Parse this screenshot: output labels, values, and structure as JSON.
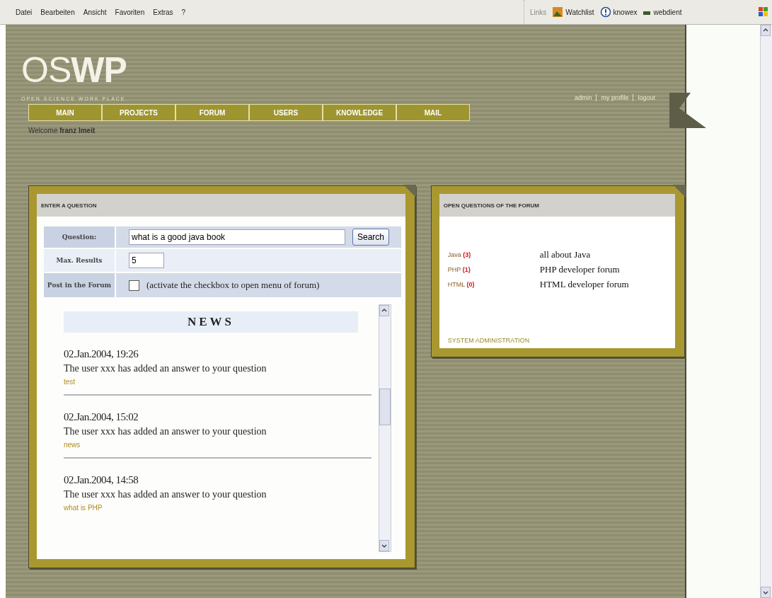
{
  "menu_bar": {
    "items": [
      "Datei",
      "Bearbeiten",
      "Ansicht",
      "Favoriten",
      "Extras",
      "?"
    ],
    "links_label": "Links",
    "links": [
      {
        "label": "Watchlist",
        "kind": "image"
      },
      {
        "label": "knowex",
        "kind": "help"
      },
      {
        "label": "webdient",
        "kind": "device"
      }
    ]
  },
  "header": {
    "logo_light": "OS",
    "logo_bold": "WP",
    "tagline": "OPEN SCIENCE WORK PLACE",
    "user_links": [
      "admin",
      "my profile",
      "logout"
    ]
  },
  "nav": [
    "MAIN",
    "PROJECTS",
    "FORUM",
    "USERS",
    "KNOWLEDGE",
    "MAIL"
  ],
  "welcome": "Welcome **franz lmeit**",
  "question_card": {
    "title": "ENTER A QUESTION",
    "question_label": "Question:",
    "question_value": "what is a good java book",
    "search_button": "Search",
    "max_label": "Max. Results",
    "max_value": "5",
    "post_label": "Post in the Forum",
    "post_checked": false,
    "post_hint": "(activate the checkbox to open menu of forum)",
    "news_title": "NEWS",
    "news": [
      {
        "date": "02.Jan.2004, 19:26",
        "text": "The user xxx has added an answer to your question",
        "link": "test"
      },
      {
        "date": "02.Jan.2004, 15:02",
        "text": "The user xxx has added an answer to your question",
        "link": "news"
      },
      {
        "date": "02.Jan.2004, 14:58",
        "text": "The user xxx has added an answer to your question",
        "link": "what is PHP"
      }
    ]
  },
  "forum_card": {
    "title": "OPEN QUESTIONS OF THE FORUM",
    "forums": [
      {
        "name": "Java",
        "count": "(3)",
        "description": "all about Java"
      },
      {
        "name": "PHP",
        "count": "(1)",
        "description": "PHP developer forum"
      },
      {
        "name": "HTML",
        "count": "(0)",
        "description": "HTML developer forum"
      }
    ],
    "admin_link": "SYSTEM ADMINISTRATION"
  }
}
